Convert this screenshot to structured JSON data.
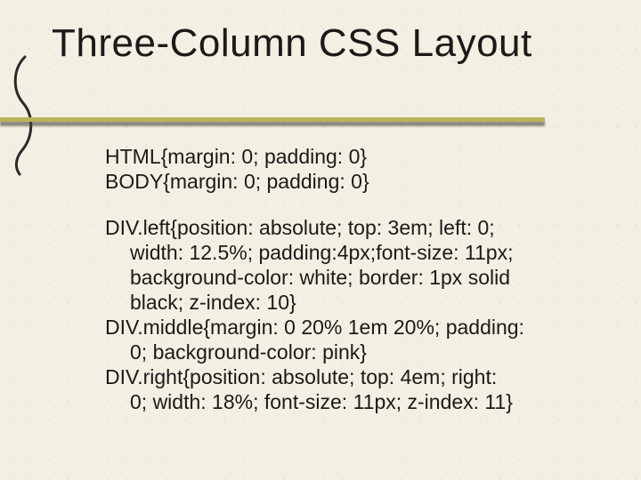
{
  "title": "Three-Column CSS Layout",
  "css_rules": {
    "p1_line1": "HTML{margin: 0; padding: 0}",
    "p1_line2": "BODY{margin: 0; padding: 0}",
    "p2_line1": "DIV.left{position: absolute; top: 3em; left: 0;",
    "p2_line2": "width: 12.5%; padding:4px;font-size: 11px;",
    "p2_line3": "background-color: white; border: 1px solid",
    "p2_line4": "black; z-index: 10}",
    "p3_line1": "DIV.middle{margin: 0 20% 1em 20%; padding:",
    "p3_line2": "0; background-color: pink}",
    "p4_line1": "DIV.right{position: absolute; top: 4em; right:",
    "p4_line2": "0; width: 18%; font-size: 11px; z-index: 11}"
  }
}
